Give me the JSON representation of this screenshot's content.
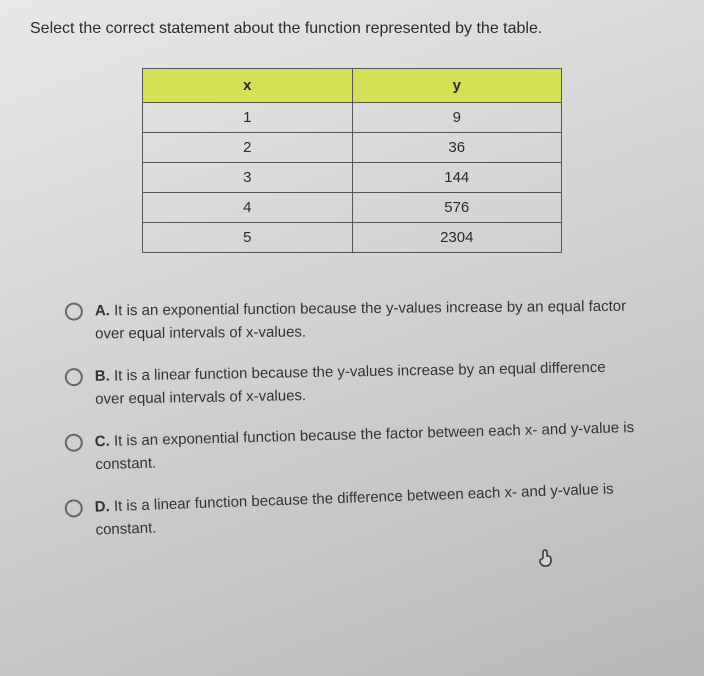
{
  "question": "Select the correct statement about the function represented by the table.",
  "table": {
    "headerX": "x",
    "headerY": "y",
    "rows": [
      {
        "x": "1",
        "y": "9"
      },
      {
        "x": "2",
        "y": "36"
      },
      {
        "x": "3",
        "y": "144"
      },
      {
        "x": "4",
        "y": "576"
      },
      {
        "x": "5",
        "y": "2304"
      }
    ]
  },
  "options": {
    "a": {
      "label": "A.",
      "text": "It is an exponential function because the y-values increase by an equal factor over equal intervals of x-values."
    },
    "b": {
      "label": "B.",
      "text": "It is a linear function because the y-values increase by an equal difference over equal intervals of x-values."
    },
    "c": {
      "label": "C.",
      "text": "It is an exponential function because the factor between each x- and y-value is constant."
    },
    "d": {
      "label": "D.",
      "text": "It is a linear function because the difference between each x- and y-value is constant."
    }
  }
}
